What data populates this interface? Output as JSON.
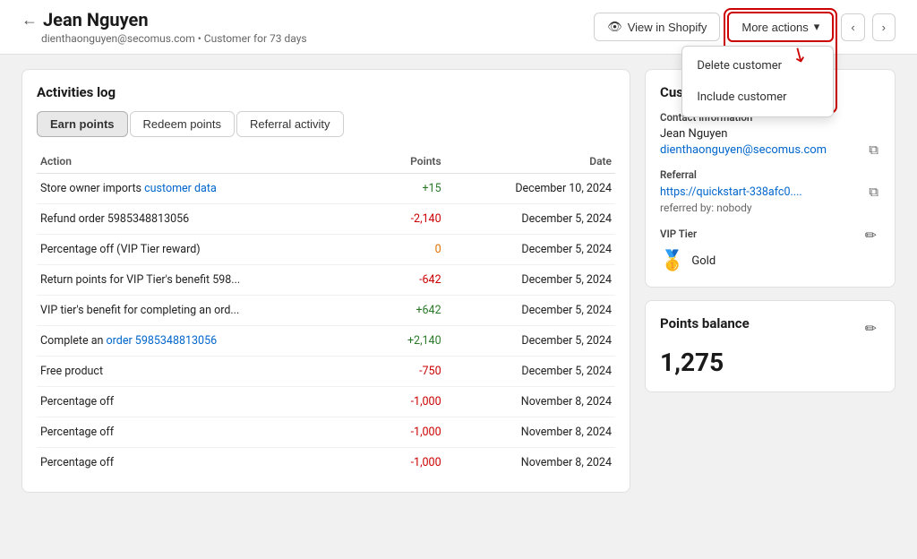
{
  "header": {
    "back_arrow": "←",
    "customer_name": "Jean Nguyen",
    "customer_email": "dienthaonguyen@secomus.com",
    "customer_since": "Customer for 73 days",
    "view_in_shopify_label": "View in Shopify",
    "more_actions_label": "More actions",
    "nav_prev": "‹",
    "nav_next": "›",
    "eye_icon": "👁"
  },
  "dropdown": {
    "items": [
      {
        "label": "Delete customer"
      },
      {
        "label": "Include customer"
      }
    ]
  },
  "activities": {
    "card_title": "Activities log",
    "tabs": [
      {
        "label": "Earn points",
        "active": true
      },
      {
        "label": "Redeem points",
        "active": false
      },
      {
        "label": "Referral activity",
        "active": false
      }
    ],
    "columns": {
      "action": "Action",
      "points": "Points",
      "date": "Date"
    },
    "rows": [
      {
        "action": "Store owner imports customer data",
        "action_link": "customer data",
        "points": "+15",
        "points_class": "text-green",
        "date": "December 10, 2024"
      },
      {
        "action": "Refund order 5985348813056",
        "points": "-2,140",
        "points_class": "text-red",
        "date": "December 5, 2024"
      },
      {
        "action": "Percentage off (VIP Tier reward)",
        "points": "0",
        "points_class": "text-orange",
        "date": "December 5, 2024"
      },
      {
        "action": "Return points for VIP Tier's benefit 598...",
        "points": "-642",
        "points_class": "text-red",
        "date": "December 5, 2024"
      },
      {
        "action": "VIP tier's benefit for completing an ord...",
        "points": "+642",
        "points_class": "text-green",
        "date": "December 5, 2024"
      },
      {
        "action": "Complete an order 5985348813056",
        "action_link": "order 5985348813056",
        "points": "+2,140",
        "points_class": "text-green",
        "date": "December 5, 2024"
      },
      {
        "action": "Free product",
        "points": "-750",
        "points_class": "text-red",
        "date": "December 5, 2024"
      },
      {
        "action": "Percentage off",
        "points": "-1,000",
        "points_class": "text-red",
        "date": "November 8, 2024"
      },
      {
        "action": "Percentage off",
        "points": "-1,000",
        "points_class": "text-red",
        "date": "November 8, 2024"
      },
      {
        "action": "Percentage off",
        "points": "-1,000",
        "points_class": "text-red",
        "date": "November 8, 2024"
      }
    ]
  },
  "customer": {
    "card_title": "Customer",
    "contact_section": "Contact information",
    "name": "Jean Nguyen",
    "email": "dienthaonguyen@secomus.com",
    "referral_section": "Referral",
    "referral_url": "https://quickstart-338afc0....",
    "referral_note": "referred by: nobody",
    "vip_section": "VIP Tier",
    "vip_tier": "Gold",
    "vip_emoji": "🥇"
  },
  "points_balance": {
    "card_title": "Points balance",
    "value": "1,275"
  }
}
